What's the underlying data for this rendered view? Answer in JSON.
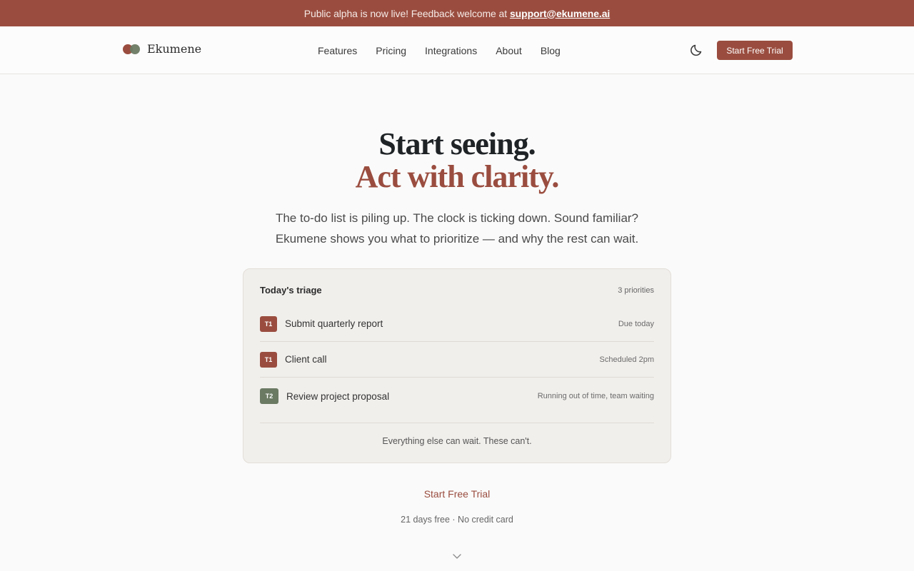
{
  "banner": {
    "text": "Public alpha is now live! Feedback welcome at",
    "email": "support@ekumene.ai"
  },
  "nav": {
    "brand": "Ekumene",
    "links": [
      "Features",
      "Pricing",
      "Integrations",
      "About",
      "Blog"
    ],
    "cta": "Start Free Trial",
    "theme_icon": "moon-icon"
  },
  "hero": {
    "line1": "Start seeing.",
    "line2": "Act with clarity.",
    "sub1": "The to-do list is piling up. The clock is ticking down. Sound familiar?",
    "sub2": "Ekumene shows you what to prioritize — and why the rest can wait."
  },
  "card": {
    "title": "Today's triage",
    "count": "3 priorities",
    "rows": [
      {
        "tag": "T1",
        "label": "Submit quarterly report",
        "meta": "Due today"
      },
      {
        "tag": "T1",
        "label": "Client call",
        "meta": "Scheduled 2pm"
      },
      {
        "tag": "T2",
        "label": "Review project proposal",
        "meta": "Running out of time, team waiting"
      }
    ],
    "footer": "Everything else can wait. These can't."
  },
  "cta": {
    "link": "Start Free Trial",
    "fine": "21 days free · No credit card"
  },
  "colors": {
    "accent": "#9a4d3f",
    "secondary": "#6b7a63"
  }
}
